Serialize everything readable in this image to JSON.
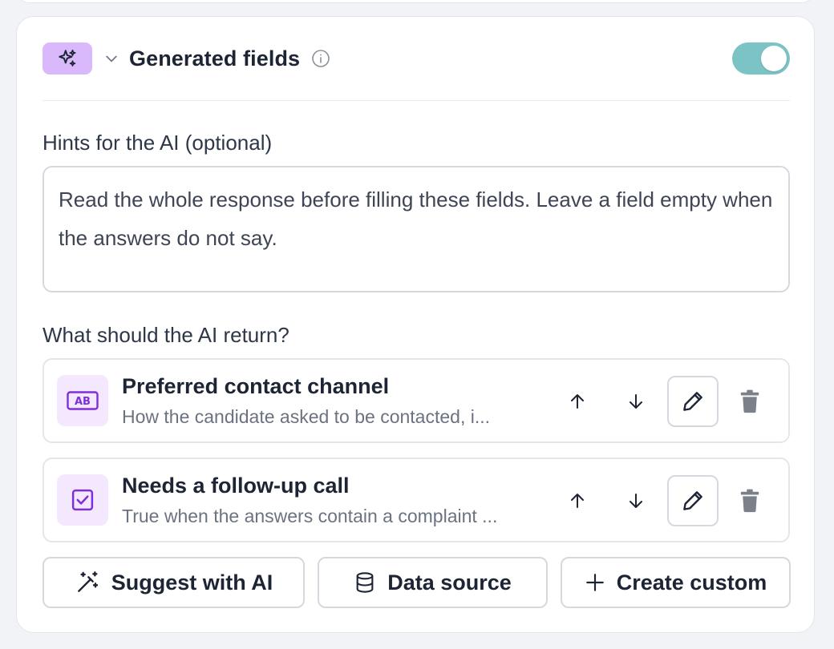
{
  "section": {
    "title": "Generated fields",
    "enabled": true,
    "colors": {
      "badge": "#d9b8fb",
      "toggle_on": "#7cc3c6",
      "field_icon_bg": "#f3e8fd",
      "field_icon_fg": "#7e2fd8"
    }
  },
  "hints": {
    "label": "Hints for the AI (optional)",
    "value": "Read the whole response before filling these fields. Leave a field empty when the answers do not say."
  },
  "fields": {
    "label": "What should the AI return?",
    "items": [
      {
        "name": "Preferred contact channel",
        "description": "How the candidate asked to be contacted, i...",
        "icon": "text-ab-icon"
      },
      {
        "name": "Needs a follow-up call",
        "description": "True when the answers contain a complaint ...",
        "icon": "checkbox-icon"
      }
    ]
  },
  "actions": {
    "suggest": "Suggest with AI",
    "data_source": "Data source",
    "create_custom": "Create custom"
  }
}
